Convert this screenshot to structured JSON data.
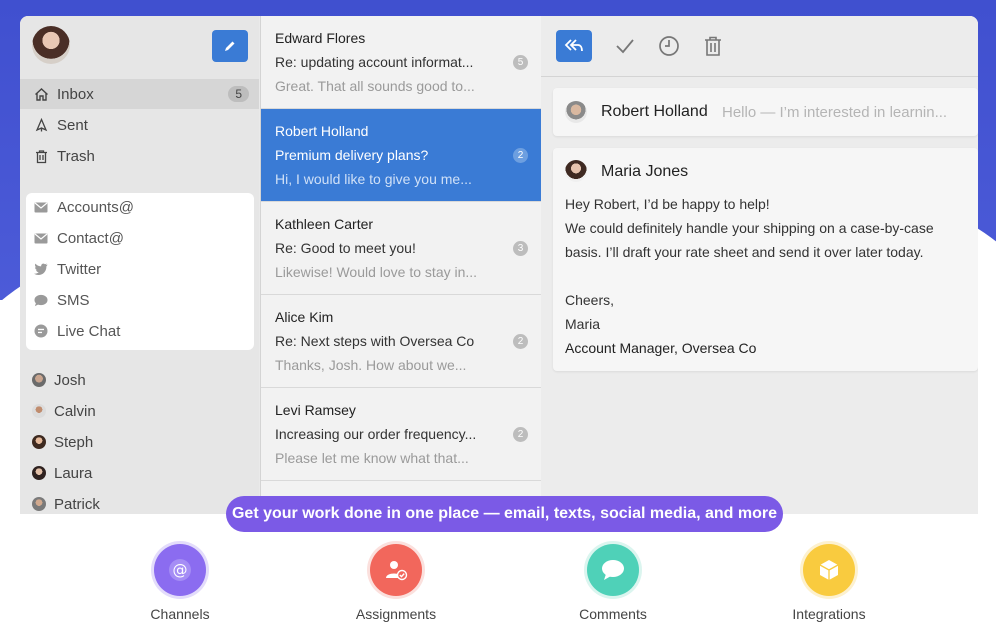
{
  "sidebar": {
    "nav": [
      {
        "label": "Inbox",
        "badge": "5",
        "icon": "home-icon"
      },
      {
        "label": "Sent",
        "icon": "sent-icon"
      },
      {
        "label": "Trash",
        "icon": "trash-icon"
      }
    ],
    "channels": [
      {
        "label": "Accounts@",
        "icon": "envelope-icon"
      },
      {
        "label": "Contact@",
        "icon": "envelope-icon"
      },
      {
        "label": "Twitter",
        "icon": "twitter-icon"
      },
      {
        "label": "SMS",
        "icon": "sms-icon"
      },
      {
        "label": "Live Chat",
        "icon": "live-chat-icon"
      }
    ],
    "teammates": [
      "Josh",
      "Calvin",
      "Steph",
      "Laura",
      "Patrick"
    ]
  },
  "conversations": [
    {
      "name": "Edward Flores",
      "subject": "Re: updating account informat...",
      "preview": "Great. That all sounds good to...",
      "count": "5"
    },
    {
      "name": "Robert Holland",
      "subject": "Premium delivery plans?",
      "preview": "Hi, I would like to give you me...",
      "count": "2"
    },
    {
      "name": "Kathleen Carter",
      "subject": "Re: Good to meet you!",
      "preview": "Likewise! Would love to stay in...",
      "count": "3"
    },
    {
      "name": "Alice Kim",
      "subject": "Re: Next steps with Oversea Co",
      "preview": "Thanks, Josh. How about we...",
      "count": "2"
    },
    {
      "name": "Levi Ramsey",
      "subject": "Increasing our order frequency...",
      "preview": "Please let me know what that...",
      "count": "2"
    }
  ],
  "detail": {
    "incoming": {
      "from": "Robert Holland",
      "preview": "Hello — I’m interested in learnin..."
    },
    "reply": {
      "from": "Maria Jones",
      "lines": [
        "Hey Robert, I’d be happy to help!",
        "We could definitely handle your shipping on a case-by-case",
        "basis. I’ll draft your rate sheet and send it over later today.",
        "Cheers,",
        "Maria",
        "Account Manager, Oversea Co"
      ]
    }
  },
  "banner": "Get your work done in one place — email, texts, social media, and more",
  "features": [
    {
      "label": "Channels",
      "color": "#8b6cf0",
      "icon": "at-icon"
    },
    {
      "label": "Assignments",
      "color": "#f2675c",
      "icon": "assign-user-icon"
    },
    {
      "label": "Comments",
      "color": "#4fd1b8",
      "icon": "comment-icon"
    },
    {
      "label": "Integrations",
      "color": "#f9cb3f",
      "icon": "cube-icon"
    }
  ],
  "colors": {
    "accent": "#3a7bd5",
    "banner": "#7b5ae6",
    "header_bg": "#4050cf"
  }
}
